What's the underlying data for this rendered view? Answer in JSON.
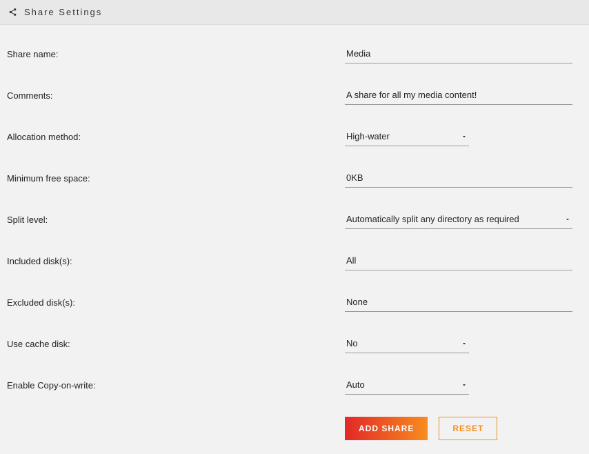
{
  "header": {
    "title": "Share Settings"
  },
  "form": {
    "share_name": {
      "label": "Share name:",
      "value": "Media"
    },
    "comments": {
      "label": "Comments:",
      "value": "A share for all my media content!"
    },
    "allocation": {
      "label": "Allocation method:",
      "value": "High-water"
    },
    "min_free": {
      "label": "Minimum free space:",
      "value": "0KB"
    },
    "split_level": {
      "label": "Split level:",
      "value": "Automatically split any directory as required"
    },
    "included": {
      "label": "Included disk(s):",
      "value": "All"
    },
    "excluded": {
      "label": "Excluded disk(s):",
      "value": "None"
    },
    "use_cache": {
      "label": "Use cache disk:",
      "value": "No"
    },
    "cow": {
      "label": "Enable Copy-on-write:",
      "value": "Auto"
    }
  },
  "buttons": {
    "add": "ADD SHARE",
    "reset": "RESET"
  }
}
